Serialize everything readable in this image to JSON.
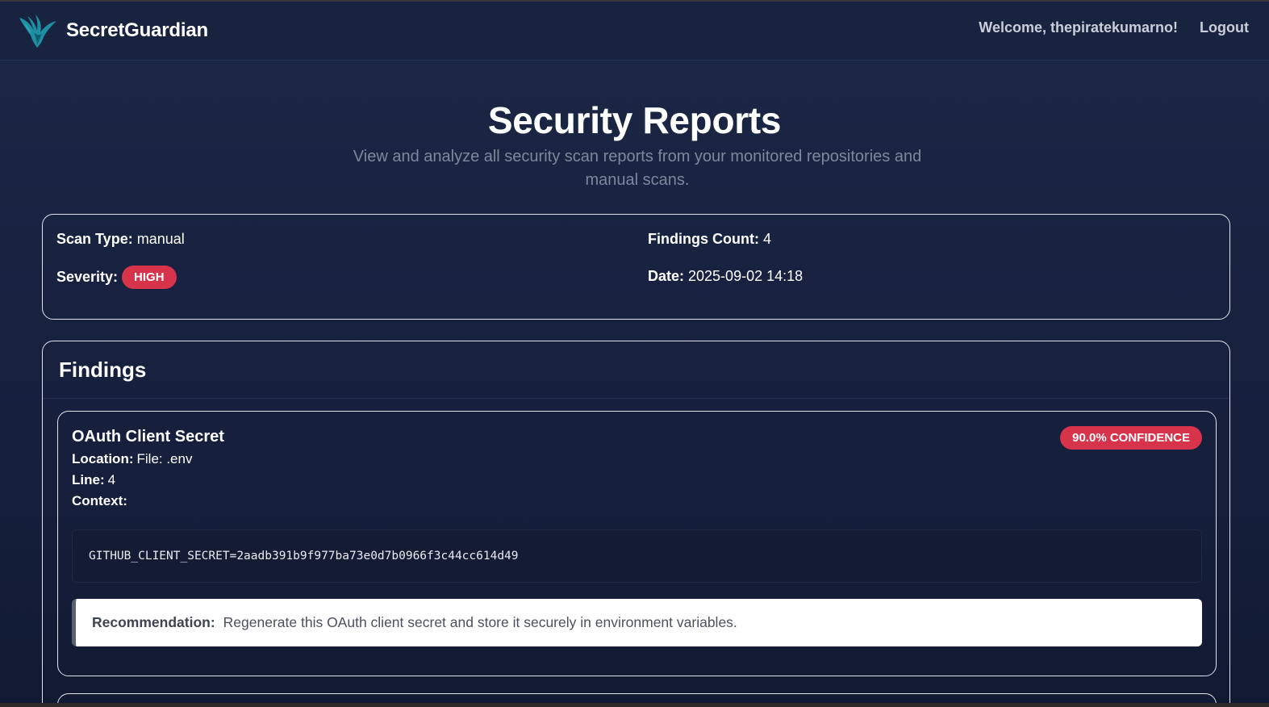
{
  "navbar": {
    "brand_name": "SecretGuardian",
    "logo_icon": "phoenix-logo-icon",
    "welcome_text": "Welcome, thepiratekumarno!",
    "logout_label": "Logout"
  },
  "header": {
    "title": "Security Reports",
    "subtitle": "View and analyze all security scan reports from your monitored repositories and manual scans."
  },
  "summary": {
    "scan_type_label": "Scan Type:",
    "scan_type_value": "manual",
    "severity_label": "Severity:",
    "severity_value": "HIGH",
    "findings_count_label": "Findings Count:",
    "findings_count_value": "4",
    "date_label": "Date:",
    "date_value": "2025-09-02 14:18"
  },
  "findings": {
    "title": "Findings",
    "items": [
      {
        "title": "OAuth Client Secret",
        "confidence_badge": "90.0% CONFIDENCE",
        "location_label": "Location:",
        "location_value": "File: .env",
        "line_label": "Line:",
        "line_value": "4",
        "context_label": "Context:",
        "context_code": "GITHUB_CLIENT_SECRET=2aadb391b9f977ba73e0d7b0966f3c44cc614d49",
        "recommendation_label": "Recommendation:",
        "recommendation_text": "Regenerate this OAuth client secret and store it securely in environment variables."
      }
    ]
  },
  "colors": {
    "background": "#18233f",
    "severity_high": "#d7334a",
    "text_muted": "#7e879c",
    "card_border": "#dfe3ec"
  }
}
